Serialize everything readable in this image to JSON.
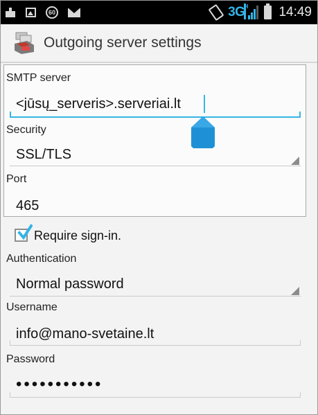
{
  "status_bar": {
    "battery_saver_label": "60",
    "network_label": "3G",
    "network_sub_label": "H",
    "time": "14:49",
    "icons": [
      "usb-icon",
      "image-icon",
      "sixty-icon",
      "mail-icon",
      "vibrate-icon",
      "signal-icon",
      "battery-icon"
    ]
  },
  "action_bar": {
    "title": "Outgoing server settings",
    "icon": "app-icon"
  },
  "form": {
    "smtp_server": {
      "label": "SMTP server",
      "value": "<jūsų_serveris>.serveriai.lt"
    },
    "security": {
      "label": "Security",
      "value": "SSL/TLS"
    },
    "port": {
      "label": "Port",
      "value": "465"
    },
    "require_sign_in": {
      "label": "Require sign-in.",
      "checked": true
    },
    "authentication": {
      "label": "Authentication",
      "value": "Normal password"
    },
    "username": {
      "label": "Username",
      "value": "info@mano-svetaine.lt"
    },
    "password": {
      "label": "Password",
      "value": "•••••••••••"
    }
  },
  "colors": {
    "accent": "#33b5e5",
    "status_bar": "#000000",
    "background": "#f3f3f3",
    "group_border": "#a8a8a8"
  }
}
